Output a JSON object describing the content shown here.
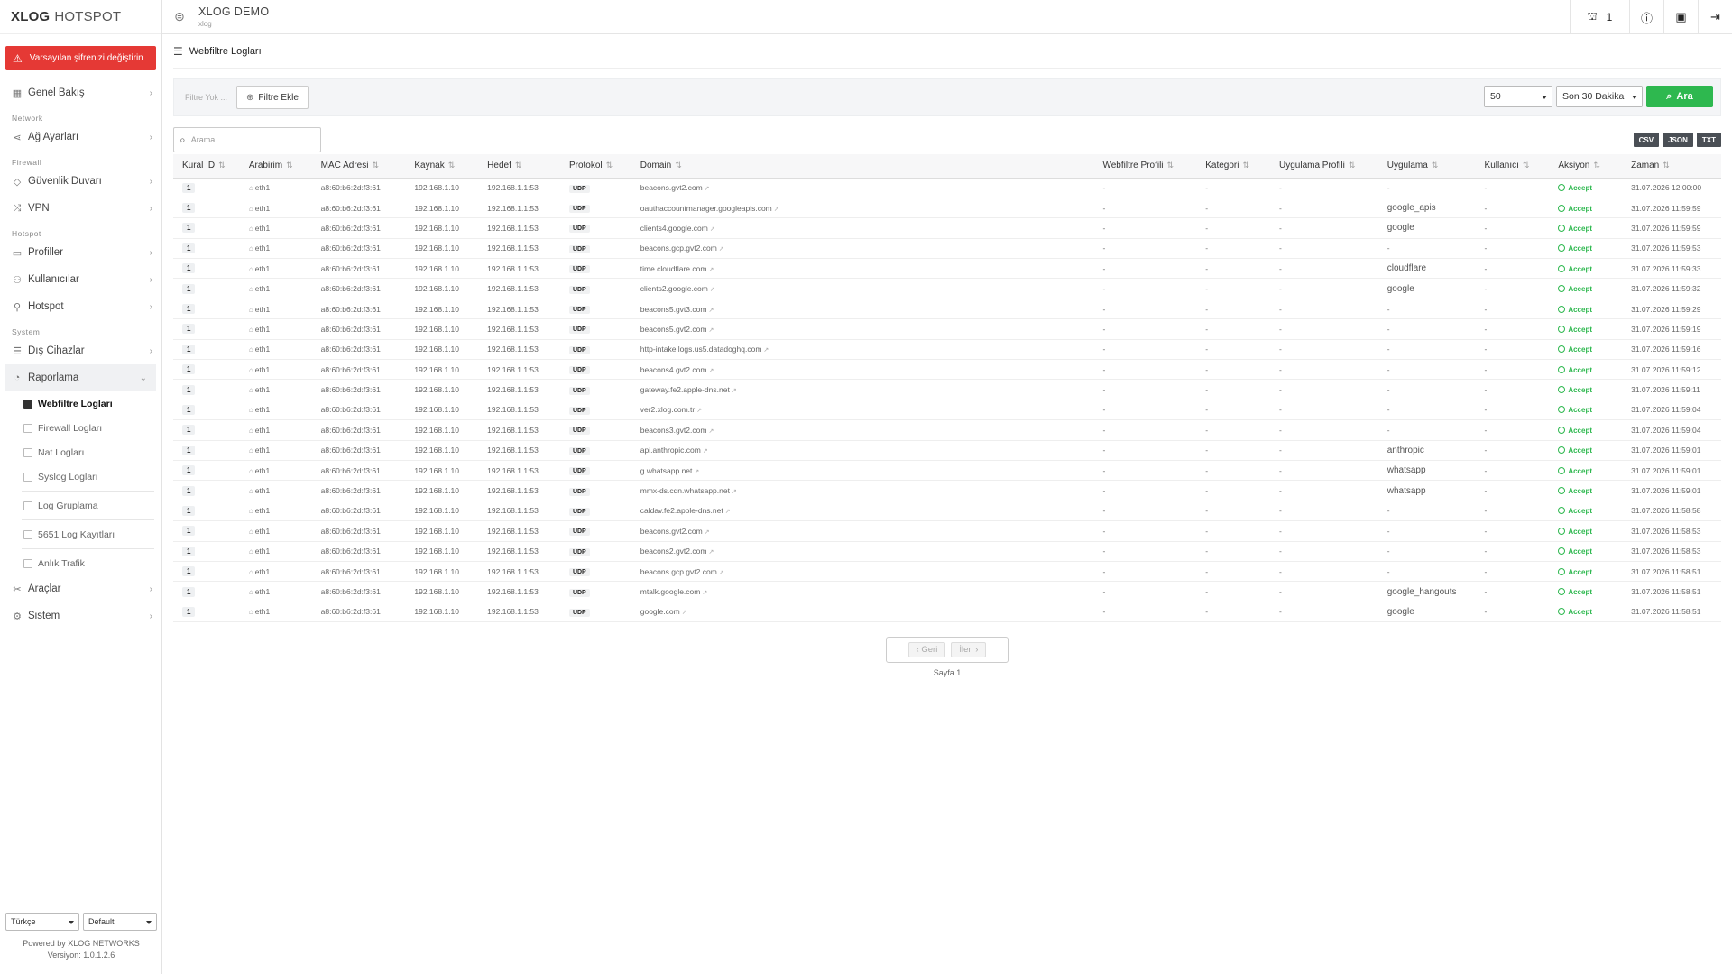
{
  "brand": {
    "bold": "XLOG",
    "light": "HOTSPOT"
  },
  "sidebar": {
    "alert": "Varsayılan şifrenizi değiştirin",
    "overview": "Genel Bakış",
    "sec_network": "Network",
    "network_settings": "Ağ Ayarları",
    "sec_firewall": "Firewall",
    "firewall": "Güvenlik Duvarı",
    "vpn": "VPN",
    "sec_hotspot": "Hotspot",
    "profiles": "Profiller",
    "users": "Kullanıcılar",
    "hotspot": "Hotspot",
    "sec_system": "System",
    "external_devices": "Dış Cihazlar",
    "reporting": "Raporlama",
    "sub_webfilter": "Webfiltre Logları",
    "sub_firewall": "Firewall Logları",
    "sub_nat": "Nat Logları",
    "sub_syslog": "Syslog Logları",
    "sub_loggroup": "Log Gruplama",
    "sub_5651": "5651 Log Kayıtları",
    "sub_live": "Anlık Trafik",
    "tools": "Araçlar",
    "system": "Sistem",
    "lang": "Türkçe",
    "theme": "Default",
    "powered": "Powered by XLOG NETWORKS",
    "version": "Versiyon: 1.0.1.2.6"
  },
  "topbar": {
    "site_name": "XLOG DEMO",
    "site_sub": "xlog",
    "online_users": "1"
  },
  "page": {
    "title": "Webfiltre Logları"
  },
  "filter": {
    "none": "Filtre Yok ...",
    "add": "Filtre Ekle",
    "count": "50",
    "range": "Son 30 Dakika",
    "search": "Ara"
  },
  "search": {
    "placeholder": "Arama..."
  },
  "exports": {
    "csv": "CSV",
    "json": "JSON",
    "txt": "TXT"
  },
  "table": {
    "headers": [
      "Kural ID",
      "Arabirim",
      "MAC Adresi",
      "Kaynak",
      "Hedef",
      "Protokol",
      "Domain",
      "Webfiltre Profili",
      "Kategori",
      "Uygulama Profili",
      "Uygulama",
      "Kullanıcı",
      "Aksiyon",
      "Zaman"
    ],
    "rows": [
      {
        "id": "1",
        "iface": "eth1",
        "mac": "a8:60:b6:2d:f3:61",
        "src": "192.168.1.10",
        "dst": "192.168.1.1:53",
        "proto": "UDP",
        "domain": "beacons.gvt2.com",
        "wf": "-",
        "cat": "-",
        "ap": "-",
        "app": "-",
        "user": "-",
        "action": "Accept",
        "time": "31.07.2026 12:00:00"
      },
      {
        "id": "1",
        "iface": "eth1",
        "mac": "a8:60:b6:2d:f3:61",
        "src": "192.168.1.10",
        "dst": "192.168.1.1:53",
        "proto": "UDP",
        "domain": "oauthaccountmanager.googleapis.com",
        "wf": "-",
        "cat": "-",
        "ap": "-",
        "app": "google_apis",
        "user": "-",
        "action": "Accept",
        "time": "31.07.2026 11:59:59"
      },
      {
        "id": "1",
        "iface": "eth1",
        "mac": "a8:60:b6:2d:f3:61",
        "src": "192.168.1.10",
        "dst": "192.168.1.1:53",
        "proto": "UDP",
        "domain": "clients4.google.com",
        "wf": "-",
        "cat": "-",
        "ap": "-",
        "app": "google",
        "user": "-",
        "action": "Accept",
        "time": "31.07.2026 11:59:59"
      },
      {
        "id": "1",
        "iface": "eth1",
        "mac": "a8:60:b6:2d:f3:61",
        "src": "192.168.1.10",
        "dst": "192.168.1.1:53",
        "proto": "UDP",
        "domain": "beacons.gcp.gvt2.com",
        "wf": "-",
        "cat": "-",
        "ap": "-",
        "app": "-",
        "user": "-",
        "action": "Accept",
        "time": "31.07.2026 11:59:53"
      },
      {
        "id": "1",
        "iface": "eth1",
        "mac": "a8:60:b6:2d:f3:61",
        "src": "192.168.1.10",
        "dst": "192.168.1.1:53",
        "proto": "UDP",
        "domain": "time.cloudflare.com",
        "wf": "-",
        "cat": "-",
        "ap": "-",
        "app": "cloudflare",
        "user": "-",
        "action": "Accept",
        "time": "31.07.2026 11:59:33"
      },
      {
        "id": "1",
        "iface": "eth1",
        "mac": "a8:60:b6:2d:f3:61",
        "src": "192.168.1.10",
        "dst": "192.168.1.1:53",
        "proto": "UDP",
        "domain": "clients2.google.com",
        "wf": "-",
        "cat": "-",
        "ap": "-",
        "app": "google",
        "user": "-",
        "action": "Accept",
        "time": "31.07.2026 11:59:32"
      },
      {
        "id": "1",
        "iface": "eth1",
        "mac": "a8:60:b6:2d:f3:61",
        "src": "192.168.1.10",
        "dst": "192.168.1.1:53",
        "proto": "UDP",
        "domain": "beacons5.gvt3.com",
        "wf": "-",
        "cat": "-",
        "ap": "-",
        "app": "-",
        "user": "-",
        "action": "Accept",
        "time": "31.07.2026 11:59:29"
      },
      {
        "id": "1",
        "iface": "eth1",
        "mac": "a8:60:b6:2d:f3:61",
        "src": "192.168.1.10",
        "dst": "192.168.1.1:53",
        "proto": "UDP",
        "domain": "beacons5.gvt2.com",
        "wf": "-",
        "cat": "-",
        "ap": "-",
        "app": "-",
        "user": "-",
        "action": "Accept",
        "time": "31.07.2026 11:59:19"
      },
      {
        "id": "1",
        "iface": "eth1",
        "mac": "a8:60:b6:2d:f3:61",
        "src": "192.168.1.10",
        "dst": "192.168.1.1:53",
        "proto": "UDP",
        "domain": "http-intake.logs.us5.datadoghq.com",
        "wf": "-",
        "cat": "-",
        "ap": "-",
        "app": "-",
        "user": "-",
        "action": "Accept",
        "time": "31.07.2026 11:59:16"
      },
      {
        "id": "1",
        "iface": "eth1",
        "mac": "a8:60:b6:2d:f3:61",
        "src": "192.168.1.10",
        "dst": "192.168.1.1:53",
        "proto": "UDP",
        "domain": "beacons4.gvt2.com",
        "wf": "-",
        "cat": "-",
        "ap": "-",
        "app": "-",
        "user": "-",
        "action": "Accept",
        "time": "31.07.2026 11:59:12"
      },
      {
        "id": "1",
        "iface": "eth1",
        "mac": "a8:60:b6:2d:f3:61",
        "src": "192.168.1.10",
        "dst": "192.168.1.1:53",
        "proto": "UDP",
        "domain": "gateway.fe2.apple-dns.net",
        "wf": "-",
        "cat": "-",
        "ap": "-",
        "app": "-",
        "user": "-",
        "action": "Accept",
        "time": "31.07.2026 11:59:11"
      },
      {
        "id": "1",
        "iface": "eth1",
        "mac": "a8:60:b6:2d:f3:61",
        "src": "192.168.1.10",
        "dst": "192.168.1.1:53",
        "proto": "UDP",
        "domain": "ver2.xlog.com.tr",
        "wf": "-",
        "cat": "-",
        "ap": "-",
        "app": "-",
        "user": "-",
        "action": "Accept",
        "time": "31.07.2026 11:59:04"
      },
      {
        "id": "1",
        "iface": "eth1",
        "mac": "a8:60:b6:2d:f3:61",
        "src": "192.168.1.10",
        "dst": "192.168.1.1:53",
        "proto": "UDP",
        "domain": "beacons3.gvt2.com",
        "wf": "-",
        "cat": "-",
        "ap": "-",
        "app": "-",
        "user": "-",
        "action": "Accept",
        "time": "31.07.2026 11:59:04"
      },
      {
        "id": "1",
        "iface": "eth1",
        "mac": "a8:60:b6:2d:f3:61",
        "src": "192.168.1.10",
        "dst": "192.168.1.1:53",
        "proto": "UDP",
        "domain": "api.anthropic.com",
        "wf": "-",
        "cat": "-",
        "ap": "-",
        "app": "anthropic",
        "user": "-",
        "action": "Accept",
        "time": "31.07.2026 11:59:01"
      },
      {
        "id": "1",
        "iface": "eth1",
        "mac": "a8:60:b6:2d:f3:61",
        "src": "192.168.1.10",
        "dst": "192.168.1.1:53",
        "proto": "UDP",
        "domain": "g.whatsapp.net",
        "wf": "-",
        "cat": "-",
        "ap": "-",
        "app": "whatsapp",
        "user": "-",
        "action": "Accept",
        "time": "31.07.2026 11:59:01"
      },
      {
        "id": "1",
        "iface": "eth1",
        "mac": "a8:60:b6:2d:f3:61",
        "src": "192.168.1.10",
        "dst": "192.168.1.1:53",
        "proto": "UDP",
        "domain": "mmx-ds.cdn.whatsapp.net",
        "wf": "-",
        "cat": "-",
        "ap": "-",
        "app": "whatsapp",
        "user": "-",
        "action": "Accept",
        "time": "31.07.2026 11:59:01"
      },
      {
        "id": "1",
        "iface": "eth1",
        "mac": "a8:60:b6:2d:f3:61",
        "src": "192.168.1.10",
        "dst": "192.168.1.1:53",
        "proto": "UDP",
        "domain": "caldav.fe2.apple-dns.net",
        "wf": "-",
        "cat": "-",
        "ap": "-",
        "app": "-",
        "user": "-",
        "action": "Accept",
        "time": "31.07.2026 11:58:58"
      },
      {
        "id": "1",
        "iface": "eth1",
        "mac": "a8:60:b6:2d:f3:61",
        "src": "192.168.1.10",
        "dst": "192.168.1.1:53",
        "proto": "UDP",
        "domain": "beacons.gvt2.com",
        "wf": "-",
        "cat": "-",
        "ap": "-",
        "app": "-",
        "user": "-",
        "action": "Accept",
        "time": "31.07.2026 11:58:53"
      },
      {
        "id": "1",
        "iface": "eth1",
        "mac": "a8:60:b6:2d:f3:61",
        "src": "192.168.1.10",
        "dst": "192.168.1.1:53",
        "proto": "UDP",
        "domain": "beacons2.gvt2.com",
        "wf": "-",
        "cat": "-",
        "ap": "-",
        "app": "-",
        "user": "-",
        "action": "Accept",
        "time": "31.07.2026 11:58:53"
      },
      {
        "id": "1",
        "iface": "eth1",
        "mac": "a8:60:b6:2d:f3:61",
        "src": "192.168.1.10",
        "dst": "192.168.1.1:53",
        "proto": "UDP",
        "domain": "beacons.gcp.gvt2.com",
        "wf": "-",
        "cat": "-",
        "ap": "-",
        "app": "-",
        "user": "-",
        "action": "Accept",
        "time": "31.07.2026 11:58:51"
      },
      {
        "id": "1",
        "iface": "eth1",
        "mac": "a8:60:b6:2d:f3:61",
        "src": "192.168.1.10",
        "dst": "192.168.1.1:53",
        "proto": "UDP",
        "domain": "mtalk.google.com",
        "wf": "-",
        "cat": "-",
        "ap": "-",
        "app": "google_hangouts",
        "user": "-",
        "action": "Accept",
        "time": "31.07.2026 11:58:51"
      },
      {
        "id": "1",
        "iface": "eth1",
        "mac": "a8:60:b6:2d:f3:61",
        "src": "192.168.1.10",
        "dst": "192.168.1.1:53",
        "proto": "UDP",
        "domain": "google.com",
        "wf": "-",
        "cat": "-",
        "ap": "-",
        "app": "google",
        "user": "-",
        "action": "Accept",
        "time": "31.07.2026 11:58:51"
      }
    ]
  },
  "pager": {
    "prev": "Geri",
    "next": "İleri",
    "page_label": "Sayfa 1"
  }
}
